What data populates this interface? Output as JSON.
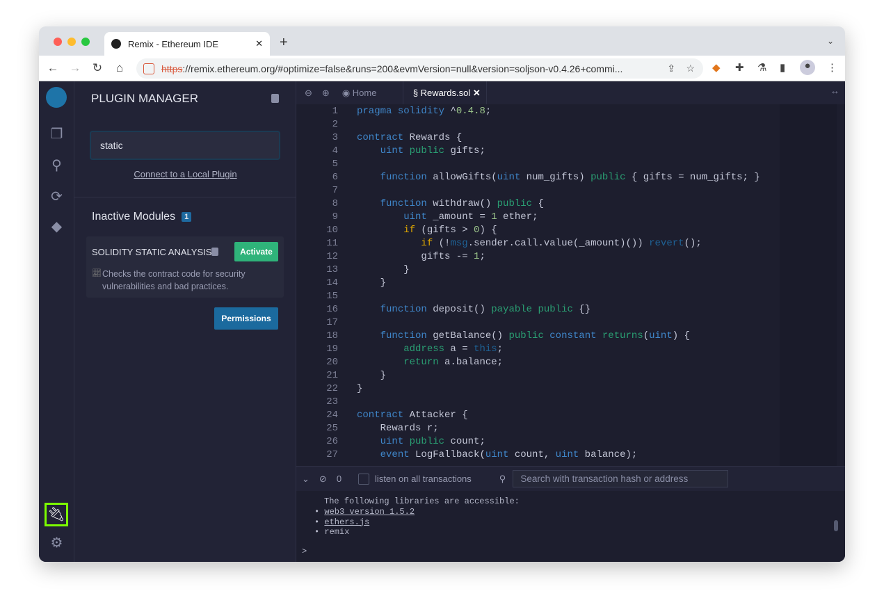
{
  "browser": {
    "tab_title": "Remix - Ethereum IDE",
    "url_scheme": "https",
    "url_rest": "://remix.ethereum.org/#optimize=false&runs=200&evmVersion=null&version=soljson-v0.4.26+commi..."
  },
  "panel": {
    "title": "PLUGIN MANAGER",
    "search_value": "static",
    "connect_link": "Connect to a Local Plugin",
    "inactive_title": "Inactive Modules",
    "inactive_count": "1",
    "module": {
      "name": "SOLIDITY STATIC ANALYSIS",
      "activate": "Activate",
      "description": "Checks the contract code for security vulnerabilities and bad practices."
    },
    "permissions": "Permissions"
  },
  "editor": {
    "tabs": [
      {
        "label": "Home"
      },
      {
        "label": "Rewards.sol"
      }
    ],
    "lines": [
      [
        [
          "kw",
          "pragma"
        ],
        [
          "p",
          " "
        ],
        [
          "kw",
          "solidity"
        ],
        [
          "p",
          " ^"
        ],
        [
          "num",
          "0.4.8"
        ],
        [
          "p",
          ";"
        ]
      ],
      [],
      [
        [
          "kw",
          "contract"
        ],
        [
          "p",
          " Rewards {"
        ]
      ],
      [
        [
          "p",
          "    "
        ],
        [
          "kw",
          "uint"
        ],
        [
          "p",
          " "
        ],
        [
          "gr",
          "public"
        ],
        [
          "p",
          " gifts;"
        ]
      ],
      [],
      [
        [
          "p",
          "    "
        ],
        [
          "kw",
          "function"
        ],
        [
          "p",
          " allowGifts("
        ],
        [
          "kw",
          "uint"
        ],
        [
          "p",
          " num_gifts) "
        ],
        [
          "gr",
          "public"
        ],
        [
          "p",
          " { gifts = num_gifts; }"
        ]
      ],
      [],
      [
        [
          "p",
          "    "
        ],
        [
          "kw",
          "function"
        ],
        [
          "p",
          " withdraw() "
        ],
        [
          "gr",
          "public"
        ],
        [
          "p",
          " {"
        ]
      ],
      [
        [
          "p",
          "        "
        ],
        [
          "kw",
          "uint"
        ],
        [
          "p",
          " _amount = "
        ],
        [
          "num",
          "1"
        ],
        [
          "p",
          " ether;"
        ]
      ],
      [
        [
          "p",
          "        "
        ],
        [
          "yl",
          "if"
        ],
        [
          "p",
          " (gifts > "
        ],
        [
          "num",
          "0"
        ],
        [
          "p",
          ") {"
        ]
      ],
      [
        [
          "p",
          "           "
        ],
        [
          "yl",
          "if"
        ],
        [
          "p",
          " (!"
        ],
        [
          "dk",
          "msg"
        ],
        [
          "p",
          ".sender.call.value(_amount)()) "
        ],
        [
          "dk",
          "revert"
        ],
        [
          "p",
          "();"
        ]
      ],
      [
        [
          "p",
          "           gifts -= "
        ],
        [
          "num",
          "1"
        ],
        [
          "p",
          ";"
        ]
      ],
      [
        [
          "p",
          "        }"
        ]
      ],
      [
        [
          "p",
          "    }"
        ]
      ],
      [],
      [
        [
          "p",
          "    "
        ],
        [
          "kw",
          "function"
        ],
        [
          "p",
          " deposit() "
        ],
        [
          "gr",
          "payable"
        ],
        [
          "p",
          " "
        ],
        [
          "gr",
          "public"
        ],
        [
          "p",
          " {}"
        ]
      ],
      [],
      [
        [
          "p",
          "    "
        ],
        [
          "kw",
          "function"
        ],
        [
          "p",
          " getBalance() "
        ],
        [
          "gr",
          "public"
        ],
        [
          "p",
          " "
        ],
        [
          "kw",
          "constant"
        ],
        [
          "p",
          " "
        ],
        [
          "gr",
          "returns"
        ],
        [
          "p",
          "("
        ],
        [
          "kw",
          "uint"
        ],
        [
          "p",
          ") {"
        ]
      ],
      [
        [
          "p",
          "        "
        ],
        [
          "gr",
          "address"
        ],
        [
          "p",
          " a = "
        ],
        [
          "dk",
          "this"
        ],
        [
          "p",
          ";"
        ]
      ],
      [
        [
          "p",
          "        "
        ],
        [
          "gr",
          "return"
        ],
        [
          "p",
          " a.balance;"
        ]
      ],
      [
        [
          "p",
          "    }"
        ]
      ],
      [
        [
          "p",
          "}"
        ]
      ],
      [],
      [
        [
          "kw",
          "contract"
        ],
        [
          "p",
          " Attacker {"
        ]
      ],
      [
        [
          "p",
          "    Rewards r;"
        ]
      ],
      [
        [
          "p",
          "    "
        ],
        [
          "kw",
          "uint"
        ],
        [
          "p",
          " "
        ],
        [
          "gr",
          "public"
        ],
        [
          "p",
          " count;"
        ]
      ],
      [
        [
          "p",
          "    "
        ],
        [
          "kw",
          "event"
        ],
        [
          "p",
          " LogFallback("
        ],
        [
          "kw",
          "uint"
        ],
        [
          "p",
          " count, "
        ],
        [
          "kw",
          "uint"
        ],
        [
          "p",
          " balance);"
        ]
      ]
    ]
  },
  "terminal": {
    "count": "0",
    "listen_label": "listen on all transactions",
    "search_placeholder": "Search with transaction hash or address",
    "intro": "The following libraries are accessible:",
    "libs": [
      "web3 version 1.5.2",
      "ethers.js",
      "remix"
    ],
    "prompt": ">"
  }
}
